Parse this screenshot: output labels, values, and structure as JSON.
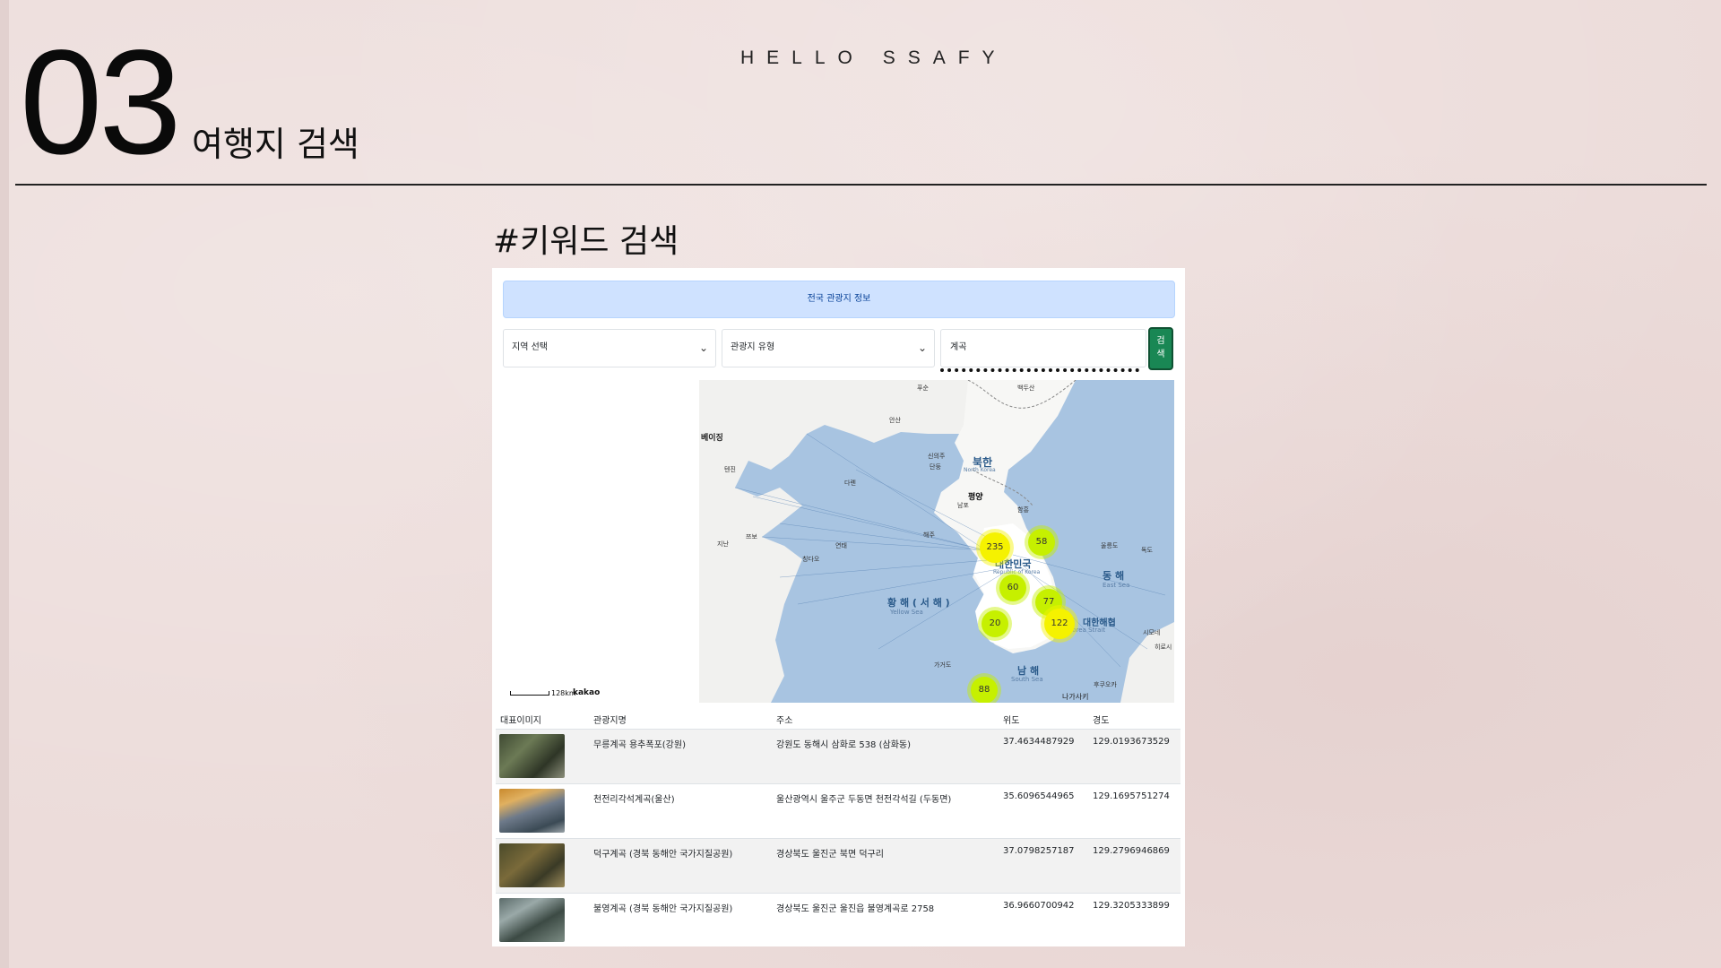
{
  "slide": {
    "number": "03",
    "title": "여행지 검색",
    "brand": "HELLO SSAFY",
    "section_title": "#키워드 검색"
  },
  "app": {
    "banner": "전국 관광지 정보",
    "region_select": "지역 선택",
    "type_select": "관광지 유형",
    "keyword_value": "계곡",
    "search_button": "검색"
  },
  "map": {
    "labels": [
      "베이징",
      "텐진",
      "다롄",
      "지난",
      "쯔보",
      "칭다오",
      "안산",
      "단둥",
      "신의주",
      "북한",
      "North Korea",
      "평양",
      "남포",
      "함흥",
      "개성",
      "연태",
      "해주",
      "대한민국",
      "Republic of Korea",
      "황 해 ( 서 해 )",
      "Yellow Sea",
      "동 해",
      "East Sea",
      "울릉도",
      "독도",
      "대한해협",
      "Korea Strait",
      "남 해",
      "South Sea",
      "가거도",
      "후쿠오카",
      "나가사키",
      "시모네",
      "히로시",
      "푸순",
      "백두산"
    ],
    "clusters": [
      {
        "label": "235",
        "color": "#f5f200"
      },
      {
        "label": "58",
        "color": "#c6f000"
      },
      {
        "label": "60",
        "color": "#c6f000"
      },
      {
        "label": "77",
        "color": "#c6f000"
      },
      {
        "label": "20",
        "color": "#c6f000"
      },
      {
        "label": "122",
        "color": "#f5f200"
      },
      {
        "label": "88",
        "color": "#c6f000"
      }
    ],
    "scale_label": "128km",
    "logo": "kakao"
  },
  "table": {
    "headers": [
      "대표이미지",
      "관광지명",
      "주소",
      "위도",
      "경도"
    ],
    "rows": [
      {
        "name": "무릉계곡 용추폭포(강원)",
        "address": "강원도 동해시 삼화로 538 (삼화동)",
        "lat": "37.4634487929",
        "lng": "129.0193673529"
      },
      {
        "name": "천전리각석계곡(울산)",
        "address": "울산광역시 울주군 두동면 천전각석길 (두동면)",
        "lat": "35.6096544965",
        "lng": "129.1695751274"
      },
      {
        "name": "덕구계곡 (경북 동해안 국가지질공원)",
        "address": "경상북도 울진군 북면 덕구리",
        "lat": "37.0798257187",
        "lng": "129.2796946869"
      },
      {
        "name": "불영계곡 (경북 동해안 국가지질공원)",
        "address": "경상북도 울진군 울진읍 불영계곡로 2758",
        "lat": "36.9660700942",
        "lng": "129.3205333899"
      }
    ]
  }
}
